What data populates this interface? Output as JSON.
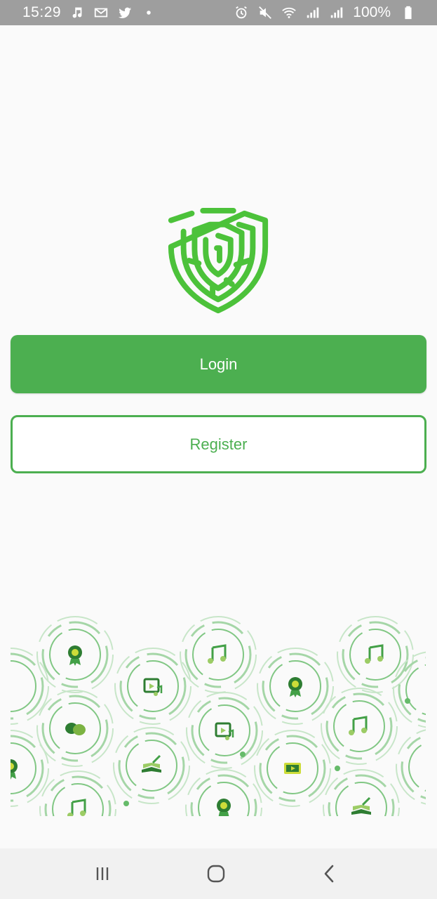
{
  "status_bar": {
    "time": "15:29",
    "battery": "100%",
    "left_icons": [
      "music-note-icon",
      "gmail-icon",
      "twitter-icon",
      "dot-icon"
    ],
    "right_icons": [
      "alarm-icon",
      "mute-icon",
      "wifi-icon",
      "signal-icon",
      "signal-icon",
      "battery-icon"
    ]
  },
  "auth": {
    "login_label": "Login",
    "register_label": "Register"
  },
  "pattern_icons": [
    "award-icon",
    "music-note-icon",
    "music-video-icon",
    "theater-masks-icon",
    "book-icon",
    "video-icon"
  ],
  "nav_bar": {
    "items": [
      "recent-apps-icon",
      "home-icon",
      "back-icon"
    ]
  },
  "colors": {
    "accent": "#4caf50",
    "logo_green": "#4cc23a",
    "status_bar_bg": "#9e9e9e",
    "background": "#fafafa"
  }
}
